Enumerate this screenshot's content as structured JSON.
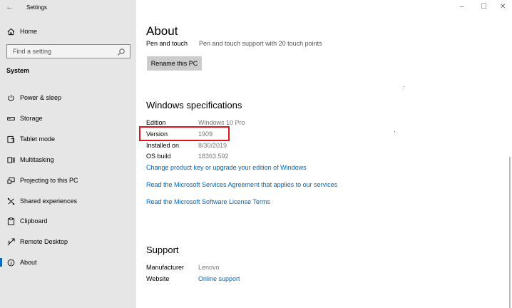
{
  "window": {
    "title": "Settings",
    "back_glyph": "←",
    "minimize_glyph": "–",
    "maximize_glyph": "☐",
    "close_glyph": "✕"
  },
  "sidebar": {
    "home_label": "Home",
    "search_placeholder": "Find a setting",
    "section_label": "System",
    "items": [
      {
        "label": "Power & sleep",
        "icon": "power-icon"
      },
      {
        "label": "Storage",
        "icon": "storage-icon"
      },
      {
        "label": "Tablet mode",
        "icon": "tablet-icon"
      },
      {
        "label": "Multitasking",
        "icon": "multitasking-icon"
      },
      {
        "label": "Projecting to this PC",
        "icon": "projecting-icon"
      },
      {
        "label": "Shared experiences",
        "icon": "shared-icon"
      },
      {
        "label": "Clipboard",
        "icon": "clipboard-icon"
      },
      {
        "label": "Remote Desktop",
        "icon": "remote-icon"
      },
      {
        "label": "About",
        "icon": "info-icon",
        "active": true
      }
    ]
  },
  "main": {
    "title": "About",
    "pen_label": "Pen and touch",
    "pen_value": "Pen and touch support with 20 touch points",
    "rename_button": "Rename this PC",
    "specs_heading": "Windows specifications",
    "specs": [
      {
        "label": "Edition",
        "value": "Windows 10 Pro"
      },
      {
        "label": "Version",
        "value": "1909"
      },
      {
        "label": "Installed on",
        "value": "8/30/2019"
      },
      {
        "label": "OS build",
        "value": "18363.592"
      }
    ],
    "links": [
      "Change product key or upgrade your edition of Windows",
      "Read the Microsoft Services Agreement that applies to our services",
      "Read the Microsoft Software License Terms"
    ],
    "support_heading": "Support",
    "support": [
      {
        "label": "Manufacturer",
        "value": "Lenovo"
      },
      {
        "label": "Website",
        "value": "Online support"
      }
    ]
  },
  "colors": {
    "accent": "#0067c0",
    "highlight": "#e0141e",
    "sidebar_bg": "#e6e6e6"
  }
}
